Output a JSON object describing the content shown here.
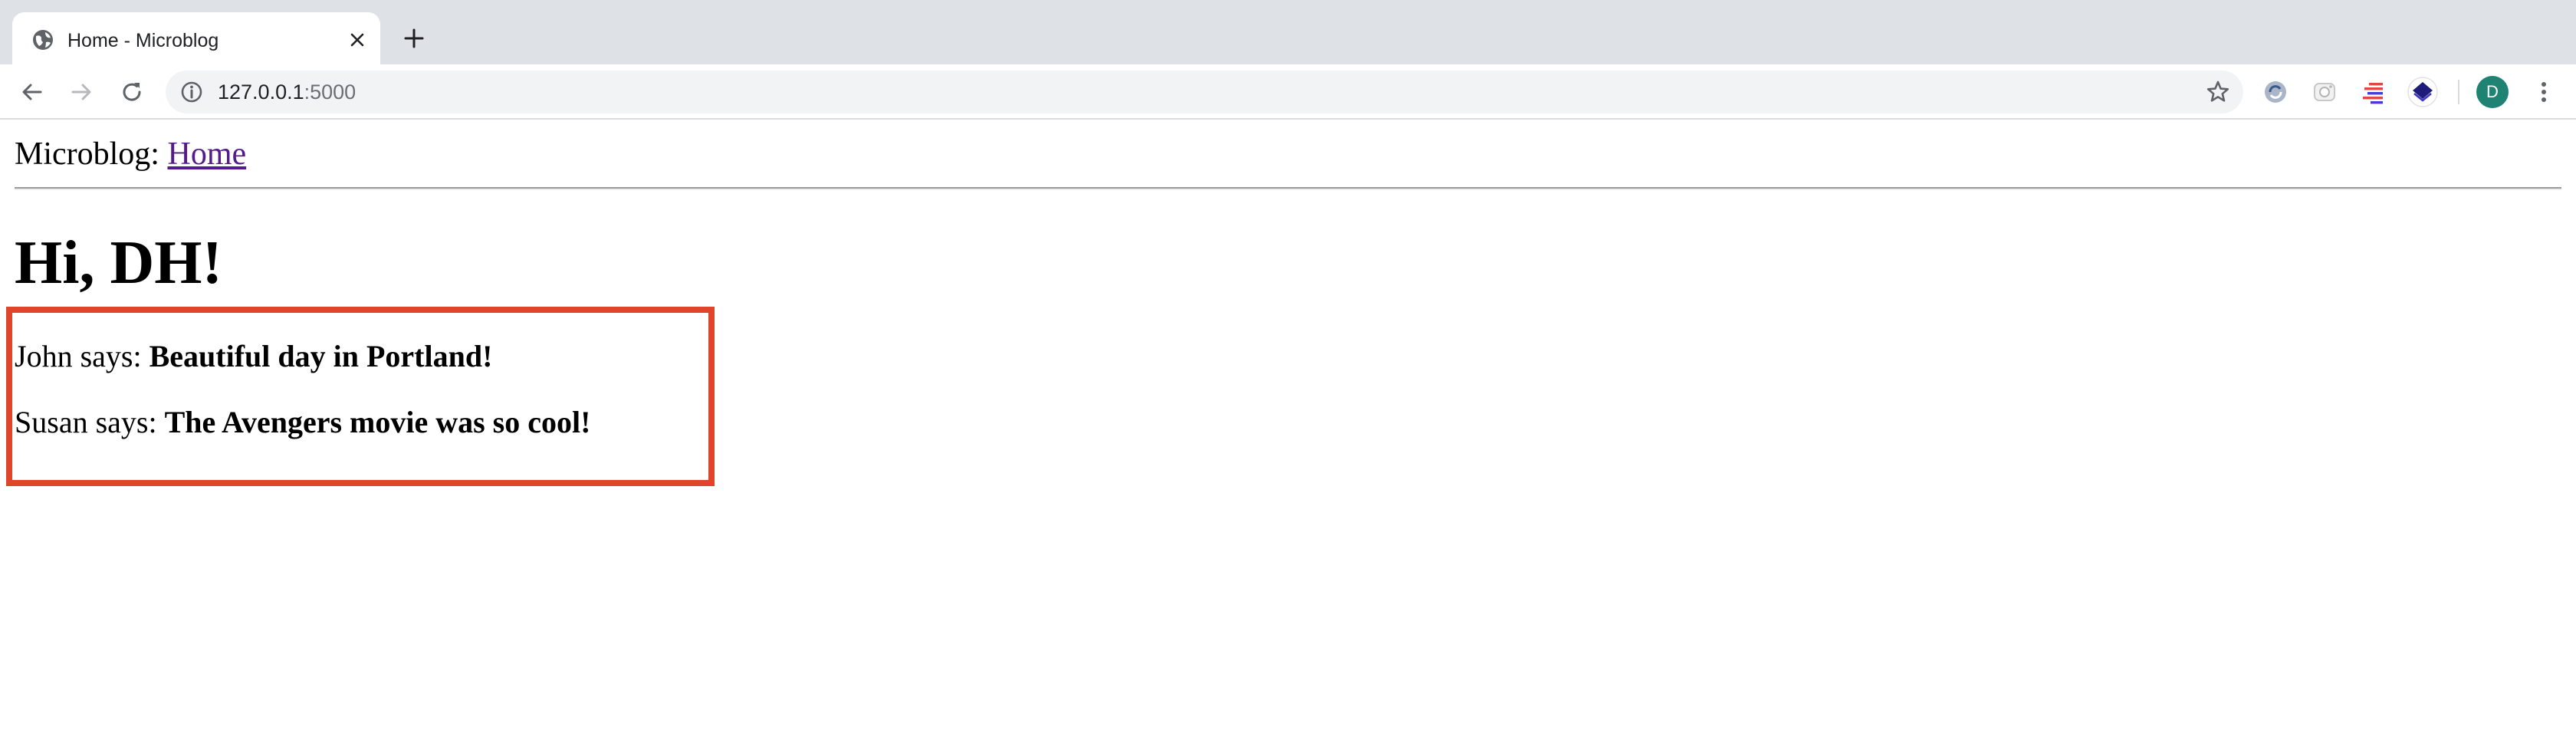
{
  "browser": {
    "tab": {
      "title": "Home - Microblog"
    },
    "address_bar": {
      "host": "127.0.0.1",
      "port": ":5000"
    },
    "profile_initial": "D",
    "extension_icons": [
      "refresh-extension-icon",
      "camera-extension-icon",
      "list-extension-icon",
      "layers-extension-icon"
    ]
  },
  "page": {
    "nav": {
      "prefix": "Microblog: ",
      "home_link": "Home"
    },
    "greeting": "Hi, DH!",
    "posts": [
      {
        "author_prefix": "John says: ",
        "body": "Beautiful day in Portland!"
      },
      {
        "author_prefix": "Susan says: ",
        "body": "The Avengers movie was so cool!"
      }
    ],
    "highlight_color": "#e0452b",
    "link_color": "#551a8b"
  }
}
